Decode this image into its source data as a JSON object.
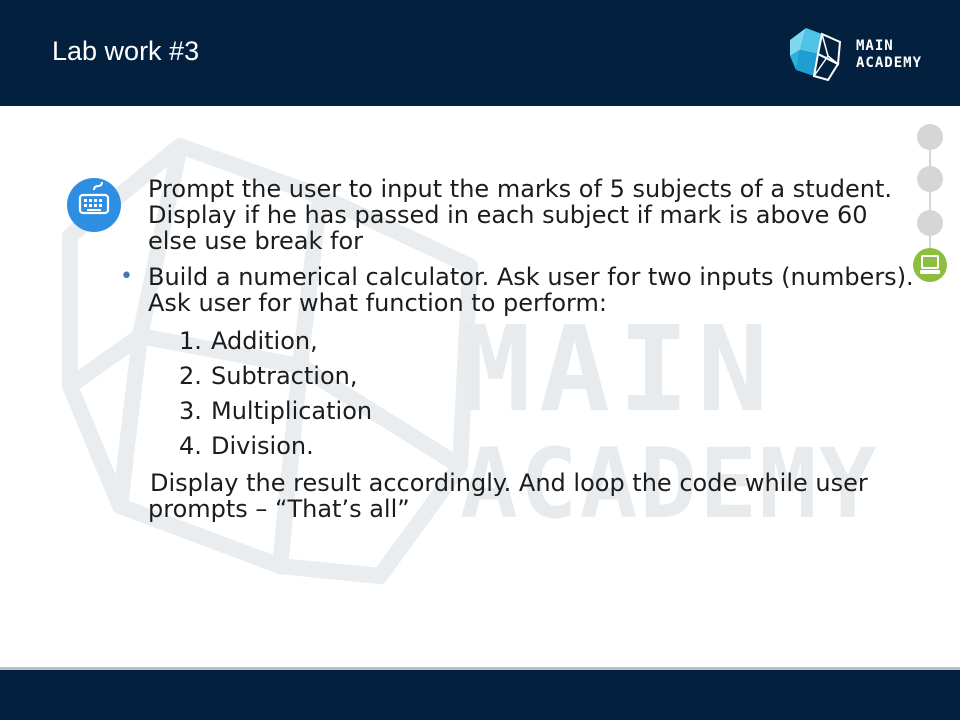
{
  "header": {
    "title": "Lab work #3",
    "logo_lines": [
      "MAIN",
      "ACADEMY"
    ]
  },
  "watermark": {
    "line1": "MAIN",
    "line2": "ACADEMY"
  },
  "content": {
    "intro": "Prompt the user to input the marks of 5 subjects of a student. Display if he has passed in each subject if mark is above 60 else use break for",
    "bullet": "Build a numerical calculator. Ask user for two inputs (numbers). Ask user for what function to perform:",
    "options": [
      {
        "num": "1.",
        "label": "Addition,"
      },
      {
        "num": "2.",
        "label": "Subtraction,"
      },
      {
        "num": "3.",
        "label": "Multiplication"
      },
      {
        "num": "4.",
        "label": "Division."
      }
    ],
    "closing": "Display the result accordingly. And loop the code while user prompts – “That’s all”"
  },
  "icons": {
    "content_badge": "keyboard-icon",
    "nav_active": "computer-icon"
  },
  "colors": {
    "header_bg": "#03213f",
    "accent_blue": "#2e8fe2",
    "accent_green": "#8dbe3f",
    "logo_teal": "#4fc3e8"
  }
}
